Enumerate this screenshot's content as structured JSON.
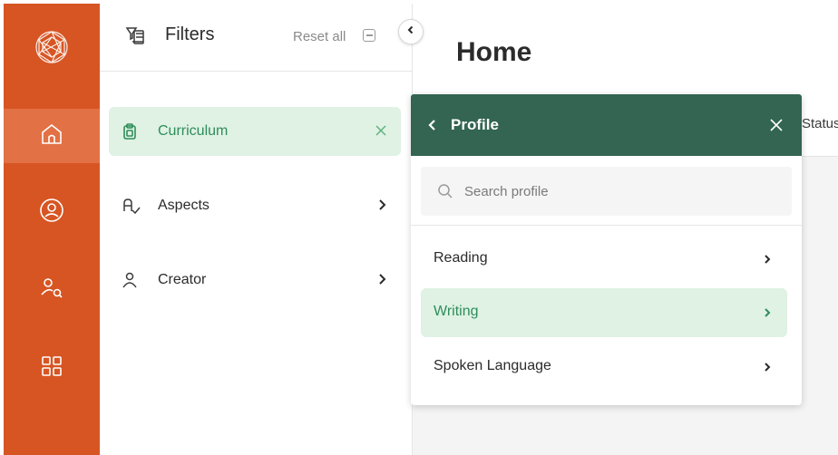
{
  "nav": {
    "items": [
      {
        "icon": "logo-icon"
      },
      {
        "icon": "home-icon",
        "active": true
      },
      {
        "icon": "user-circle-icon"
      },
      {
        "icon": "user-search-icon"
      },
      {
        "icon": "grid-icon"
      }
    ],
    "colors": {
      "background": "#d75523",
      "active": "#e27145"
    }
  },
  "filters": {
    "title": "Filters",
    "reset_label": "Reset all",
    "items": [
      {
        "label": "Curriculum",
        "icon": "clipboard-icon",
        "selected": true,
        "action": "close-icon"
      },
      {
        "label": "Aspects",
        "icon": "aspects-icon",
        "action": "chevron-right-icon"
      },
      {
        "label": "Creator",
        "icon": "person-icon",
        "action": "chevron-right-icon"
      }
    ]
  },
  "main": {
    "title": "Home",
    "status_label": "Status"
  },
  "profile": {
    "title": "Profile",
    "search_placeholder": "Search profile",
    "items": [
      {
        "label": "Reading"
      },
      {
        "label": "Writing",
        "selected": true
      },
      {
        "label": "Spoken Language"
      }
    ],
    "colors": {
      "header": "#336552",
      "selected_bg": "#dff2e4",
      "selected_text": "#2f8d5a"
    }
  }
}
